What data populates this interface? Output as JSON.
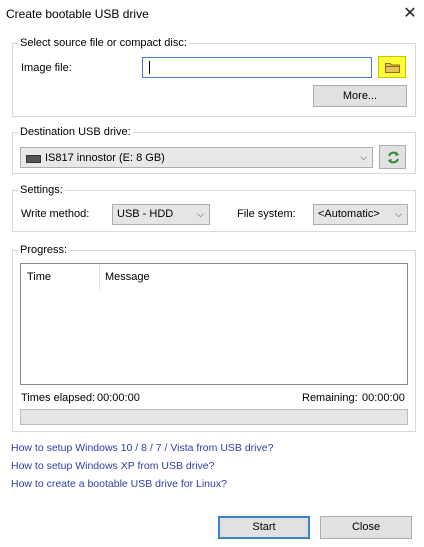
{
  "window": {
    "title": "Create bootable USB drive",
    "close_glyph": "✕"
  },
  "source": {
    "legend": "Select source file or compact disc:",
    "image_label": "Image file:",
    "image_value": "",
    "browse_icon": "folder-icon",
    "more_label": "More..."
  },
  "destination": {
    "legend": "Destination USB drive:",
    "drive_value": "IS817 innostor (E: 8 GB)",
    "refresh_icon": "refresh-icon"
  },
  "settings": {
    "legend": "Settings:",
    "write_method_label": "Write method:",
    "write_method_value": "USB - HDD",
    "file_system_label": "File system:",
    "file_system_value": "<Automatic>"
  },
  "progress": {
    "legend": "Progress:",
    "columns": [
      "Time",
      "Message"
    ],
    "elapsed_label": "Times elapsed:",
    "elapsed_value": "00:00:00",
    "remaining_label": "Remaining:",
    "remaining_value": "00:00:00",
    "progress_fraction": 0
  },
  "links": [
    "How to setup Windows 10 / 8 / 7 / Vista from USB drive?",
    "How to setup Windows XP from USB drive?",
    "How to create a bootable USB drive for Linux?"
  ],
  "buttons": {
    "start": "Start",
    "close": "Close"
  },
  "colors": {
    "highlight": "#ffff33",
    "start_border": "#3b83c9",
    "link": "#2f3caa"
  }
}
